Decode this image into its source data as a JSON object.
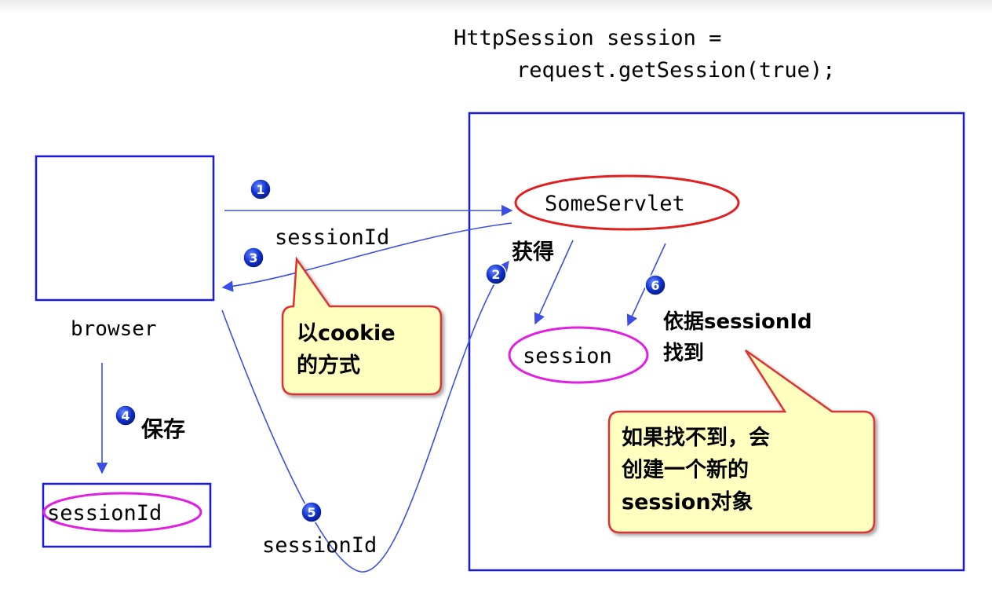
{
  "code": {
    "line1": "HttpSession session =",
    "line2": "request.getSession(true);"
  },
  "browser": {
    "label": "browser"
  },
  "servlet": {
    "label": "SomeServlet"
  },
  "session": {
    "label": "session"
  },
  "stored": {
    "label": "sessionId"
  },
  "labels": {
    "session_id_top": "sessionId",
    "session_id_bottom": "sessionId",
    "obtain": "获得",
    "save": "保存",
    "lookup_line1": "依据sessionId",
    "lookup_line2": "找到"
  },
  "callouts": {
    "cookie": {
      "line1": "以cookie",
      "line2": "的方式"
    },
    "create": {
      "line1": "如果找不到，会",
      "line2": "创建一个新的",
      "line3": "session对象"
    }
  },
  "steps": [
    "1",
    "2",
    "3",
    "4",
    "5",
    "6"
  ],
  "colors": {
    "box_border": "#1a1adc",
    "arrow": "#3b4fe6",
    "ellipse_red": "#e02020",
    "ellipse_magenta": "#e020e0",
    "callout_fill": "#ffffc0",
    "callout_border": "#e03030",
    "badge": "#1030d0"
  }
}
